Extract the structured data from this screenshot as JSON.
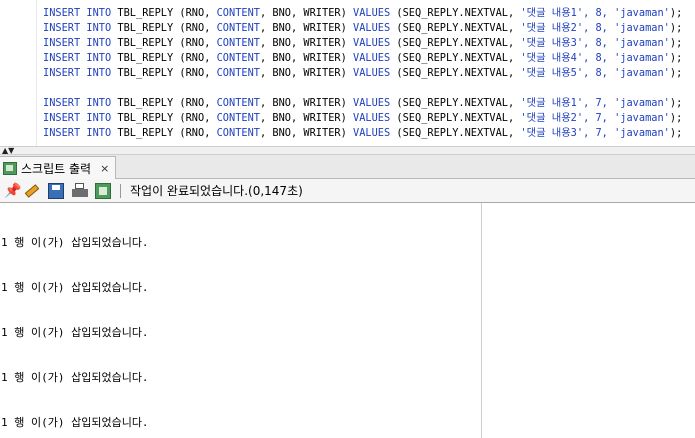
{
  "editor": {
    "lines": [
      {
        "a": "INSERT INTO",
        "b": " TBL_REPLY (RNO, ",
        "c": "CONTENT",
        "d": ", BNO, WRITER) ",
        "e": "VALUES",
        "f": " (SEQ_REPLY.NEXTVAL, ",
        "g": "'댓글 내용1', 8, 'javaman'",
        ";": ");"
      },
      {
        "a": "INSERT INTO",
        "b": " TBL_REPLY (RNO, ",
        "c": "CONTENT",
        "d": ", BNO, WRITER) ",
        "e": "VALUES",
        "f": " (SEQ_REPLY.NEXTVAL, ",
        "g": "'댓글 내용2', 8, 'javaman'",
        ";": ");"
      },
      {
        "a": "INSERT INTO",
        "b": " TBL_REPLY (RNO, ",
        "c": "CONTENT",
        "d": ", BNO, WRITER) ",
        "e": "VALUES",
        "f": " (SEQ_REPLY.NEXTVAL, ",
        "g": "'댓글 내용3', 8, 'javaman'",
        ";": ");"
      },
      {
        "a": "INSERT INTO",
        "b": " TBL_REPLY (RNO, ",
        "c": "CONTENT",
        "d": ", BNO, WRITER) ",
        "e": "VALUES",
        "f": " (SEQ_REPLY.NEXTVAL, ",
        "g": "'댓글 내용4', 8, 'javaman'",
        ";": ");"
      },
      {
        "a": "INSERT INTO",
        "b": " TBL_REPLY (RNO, ",
        "c": "CONTENT",
        "d": ", BNO, WRITER) ",
        "e": "VALUES",
        "f": " (SEQ_REPLY.NEXTVAL, ",
        "g": "'댓글 내용5', 8, 'javaman'",
        ";": ");"
      },
      {
        "a": "INSERT INTO",
        "b": " TBL_REPLY (RNO, ",
        "c": "CONTENT",
        "d": ", BNO, WRITER) ",
        "e": "VALUES",
        "f": " (SEQ_REPLY.NEXTVAL, ",
        "g": "'댓글 내용1', 7, 'javaman'",
        ";": ");"
      },
      {
        "a": "INSERT INTO",
        "b": " TBL_REPLY (RNO, ",
        "c": "CONTENT",
        "d": ", BNO, WRITER) ",
        "e": "VALUES",
        "f": " (SEQ_REPLY.NEXTVAL, ",
        "g": "'댓글 내용2', 7, 'javaman'",
        ";": ");"
      },
      {
        "a": "INSERT INTO",
        "b": " TBL_REPLY (RNO, ",
        "c": "CONTENT",
        "d": ", BNO, WRITER) ",
        "e": "VALUES",
        "f": " (SEQ_REPLY.NEXTVAL, ",
        "g": "'댓글 내용3', 7, 'javaman'",
        ";": ");"
      }
    ]
  },
  "tab": {
    "label": "스크립트 출력",
    "close": "×",
    "icon": "script-output-icon"
  },
  "toolbar": {
    "icons": [
      "pin-icon",
      "eraser-icon",
      "save-icon",
      "print-icon",
      "open-file-icon"
    ],
    "status": "작업이 완료되었습니다.(0,147초)"
  },
  "output": {
    "lines": [
      "1 행 이(가) 삽입되었습니다.",
      "1 행 이(가) 삽입되었습니다.",
      "1 행 이(가) 삽입되었습니다.",
      "1 행 이(가) 삽입되었습니다.",
      "1 행 이(가) 삽입되었습니다."
    ]
  },
  "colors": {
    "keyword": "#1f3fbf",
    "tab_bg": "#e9e9e9",
    "toolbar_bg": "#f5f5f5"
  }
}
